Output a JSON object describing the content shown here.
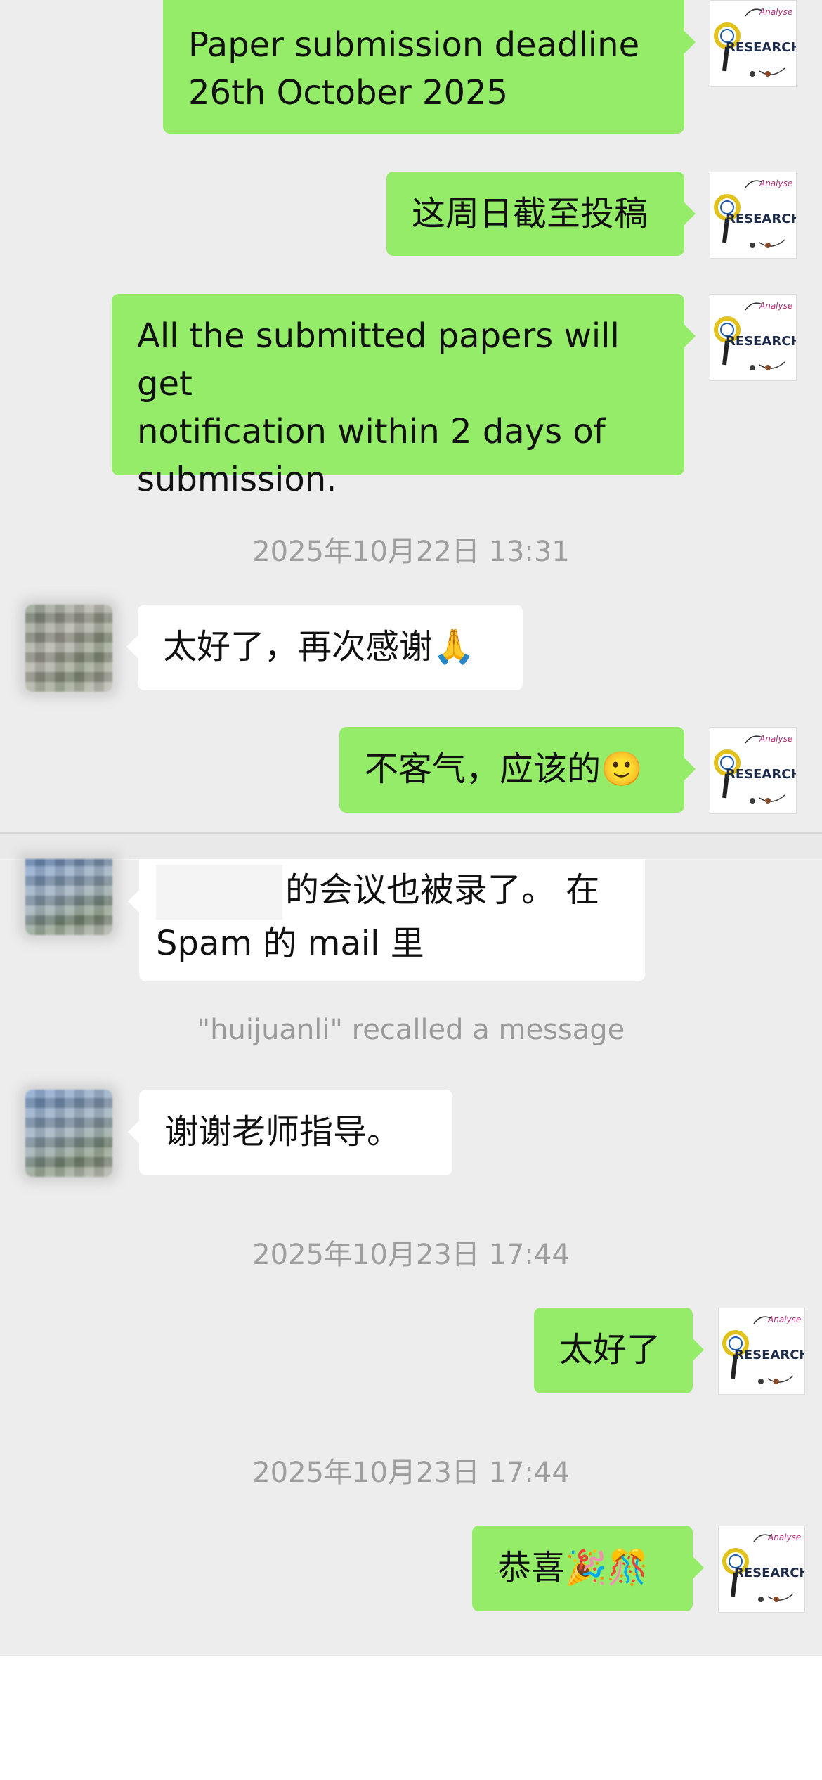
{
  "messages": [
    {
      "id": "m1",
      "side": "me",
      "lines": [
        "Paper submission deadline",
        "26th October 2025"
      ]
    },
    {
      "id": "m2",
      "side": "me",
      "text": "这周日截至投稿"
    },
    {
      "id": "m3",
      "side": "me",
      "lines": [
        "All the submitted papers will get",
        "notification within 2 days of",
        "submission."
      ]
    },
    {
      "id": "t1",
      "type": "timestamp",
      "text": "2025年10月22日 13:31"
    },
    {
      "id": "m4",
      "side": "them",
      "text": "太好了，再次感谢🙏"
    },
    {
      "id": "m5",
      "side": "me",
      "text": "不客气，应该的🙂"
    },
    {
      "id": "m6",
      "side": "them",
      "line1": "的会议也被录了。 在",
      "line2": "Spam 的 mail 里"
    },
    {
      "id": "r1",
      "type": "recall",
      "text": "\"huijuanli\" recalled a message"
    },
    {
      "id": "m7",
      "side": "them",
      "text": "谢谢老师指导。"
    },
    {
      "id": "t2",
      "type": "timestamp",
      "text": "2025年10月23日 17:44"
    },
    {
      "id": "m8",
      "side": "me",
      "text": "太好了"
    },
    {
      "id": "t3",
      "type": "timestamp",
      "text": "2025年10月23日 17:44"
    },
    {
      "id": "m9",
      "side": "me",
      "text": "恭喜🎉🎊"
    }
  ],
  "avatar_me": {
    "label": "RESEARCH",
    "badge": "Analyse"
  },
  "colors": {
    "background": "#ededed",
    "my_bubble": "#95ec69",
    "their_bubble": "#ffffff",
    "timestamp": "#9e9e9e"
  }
}
